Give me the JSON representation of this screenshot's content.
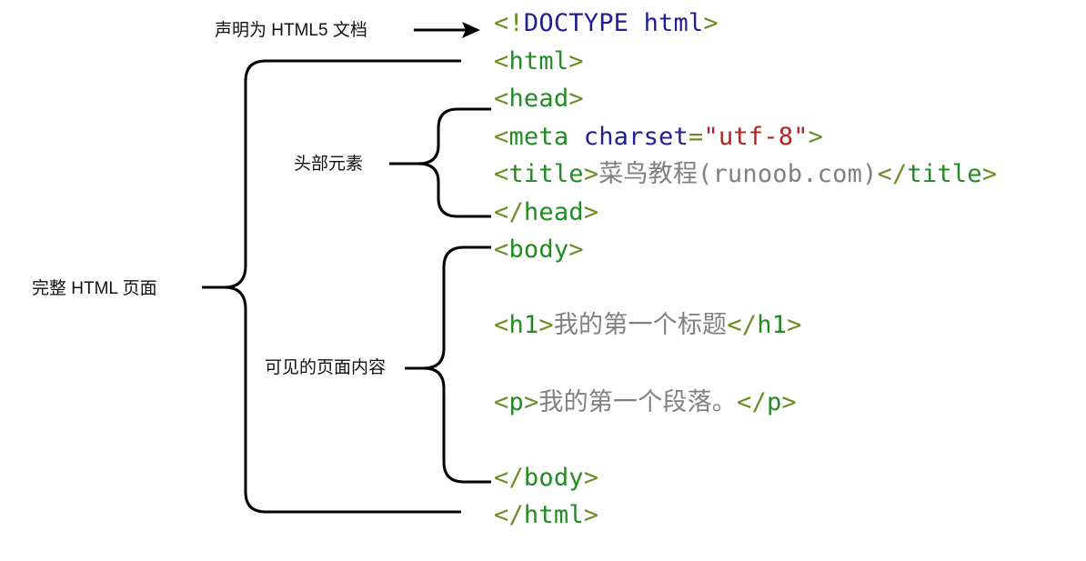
{
  "annotations": {
    "doctype_note": "声明为 HTML5 文档",
    "head_note": "头部元素",
    "page_note": "完整 HTML 页面",
    "body_note": "可见的页面内容"
  },
  "code": {
    "doctype_open": "<!",
    "doctype_keyword": "DOCTYPE html",
    "doctype_close": ">",
    "html_open_lt": "<",
    "html_open_name": "html",
    "html_open_gt": ">",
    "head_open_lt": "<",
    "head_open_name": "head",
    "head_open_gt": ">",
    "meta_lt": "<",
    "meta_name": "meta",
    "meta_attr": "charset",
    "meta_eq": "=",
    "meta_value": "\"utf-8\"",
    "meta_gt": ">",
    "title_open_lt": "<",
    "title_open_name": "title",
    "title_open_gt": ">",
    "title_text": "菜鸟教程(runoob.com)",
    "title_close_lt": "</",
    "title_close_name": "title",
    "title_close_gt": ">",
    "head_close_lt": "</",
    "head_close_name": "head",
    "head_close_gt": ">",
    "body_open_lt": "<",
    "body_open_name": "body",
    "body_open_gt": ">",
    "h1_open_lt": "<",
    "h1_open_name": "h1",
    "h1_open_gt": ">",
    "h1_text": "我的第一个标题",
    "h1_close_lt": "</",
    "h1_close_name": "h1",
    "h1_close_gt": ">",
    "p_open_lt": "<",
    "p_open_name": "p",
    "p_open_gt": ">",
    "p_text": "我的第一个段落。",
    "p_close_lt": "</",
    "p_close_name": "p",
    "p_close_gt": ">",
    "body_close_lt": "</",
    "body_close_name": "body",
    "body_close_gt": ">",
    "html_close_lt": "</",
    "html_close_name": "html",
    "html_close_gt": ">"
  },
  "colors": {
    "tag_bracket": "#6b8e23",
    "tag_name": "#228b22",
    "doctype": "#1f1f8f",
    "attribute": "#1f1f8f",
    "string": "#b22222",
    "text_content": "#808080",
    "connector": "#000000"
  }
}
